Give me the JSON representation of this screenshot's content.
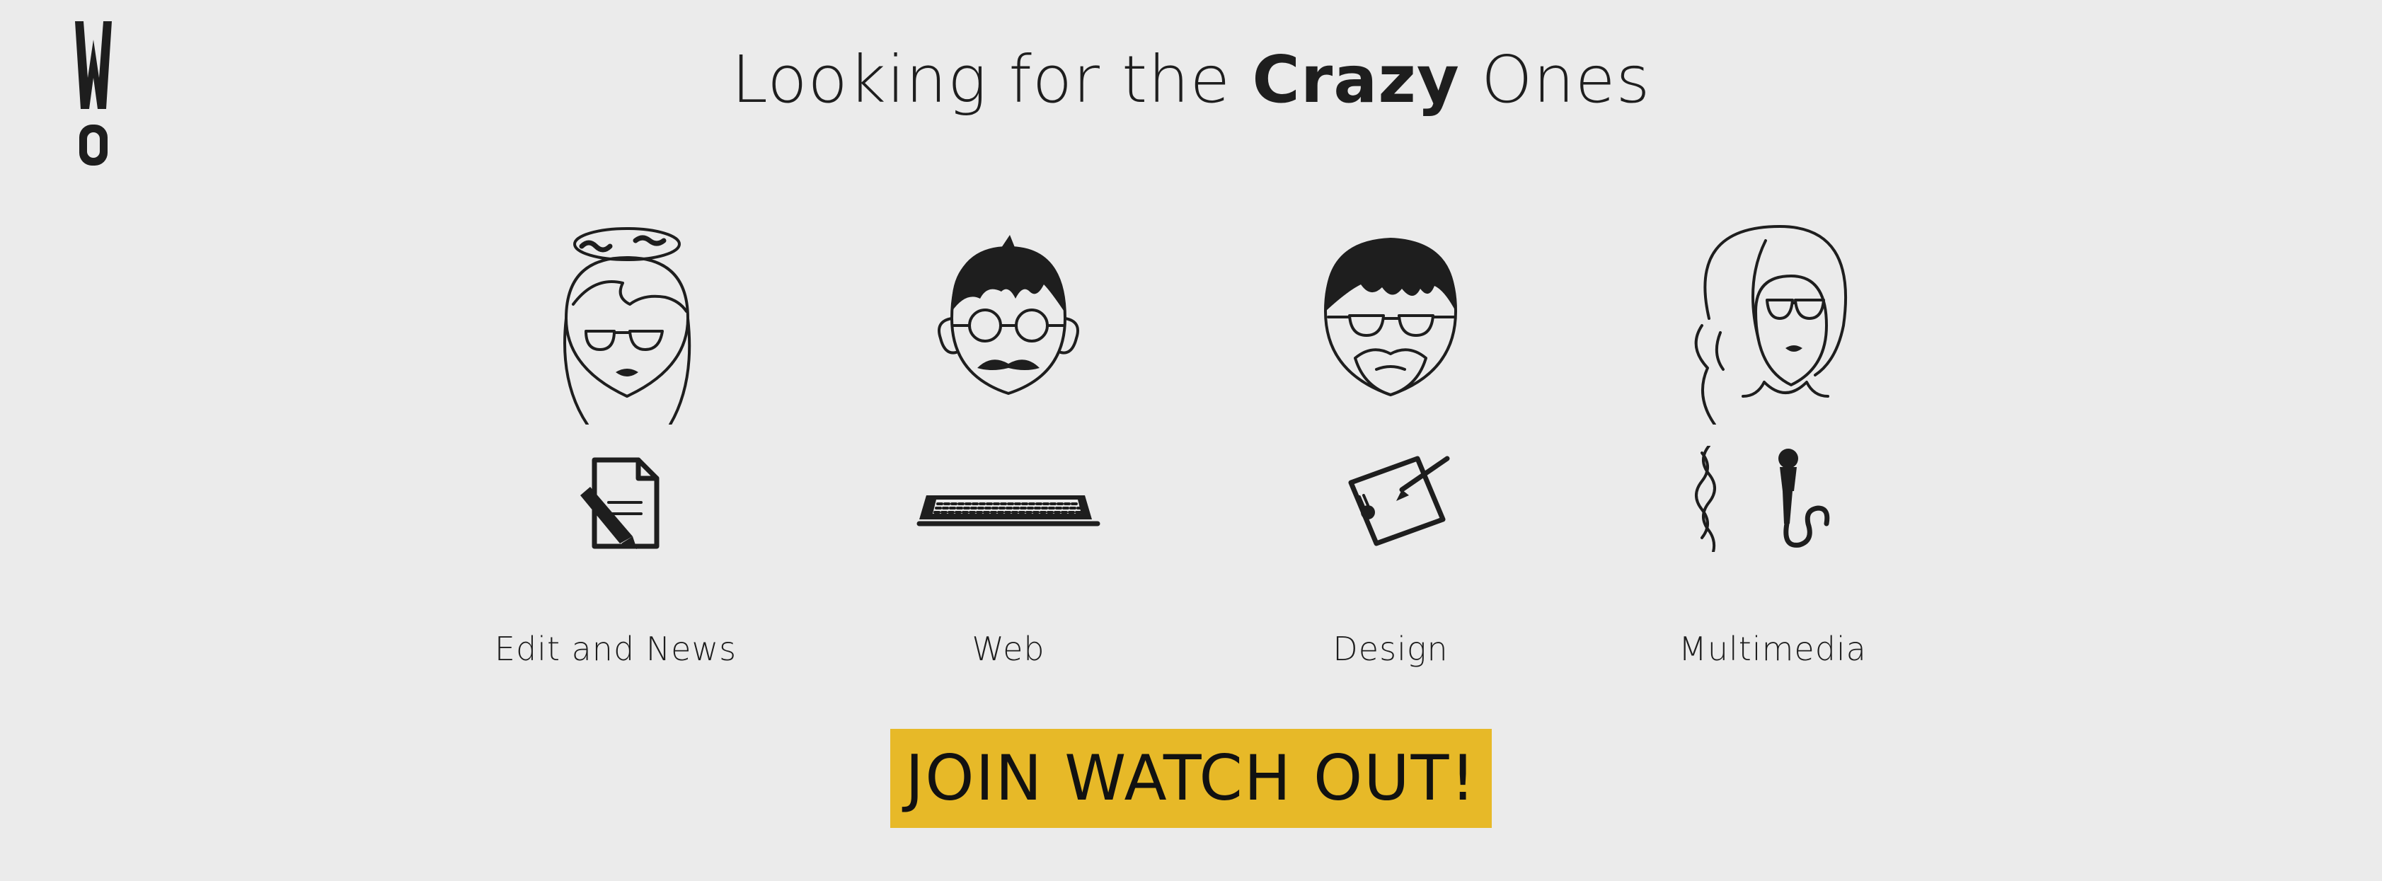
{
  "logo": {
    "letter_top": "W",
    "letter_bottom": "O"
  },
  "headline": {
    "prefix": "Looking for the",
    "emphasis": "Crazy",
    "suffix": "Ones"
  },
  "roles": [
    {
      "label": "Edit and News",
      "portrait_icon": "woman-with-bun-glasses-icon",
      "tool_icon": "document-pencil-icon"
    },
    {
      "label": "Web",
      "portrait_icon": "man-with-mustache-round-glasses-icon",
      "tool_icon": "keyboard-icon"
    },
    {
      "label": "Design",
      "portrait_icon": "man-with-beard-glasses-icon",
      "tool_icon": "drawing-tablet-icon"
    },
    {
      "label": "Multimedia",
      "portrait_icon": "woman-with-braid-glasses-icon",
      "tool_icon": "microphone-icon"
    }
  ],
  "cta": {
    "label": "JOIN WATCH OUT!"
  },
  "colors": {
    "background": "#ebebeb",
    "ink": "#1e1e1e",
    "cta_background": "#e7b928"
  }
}
